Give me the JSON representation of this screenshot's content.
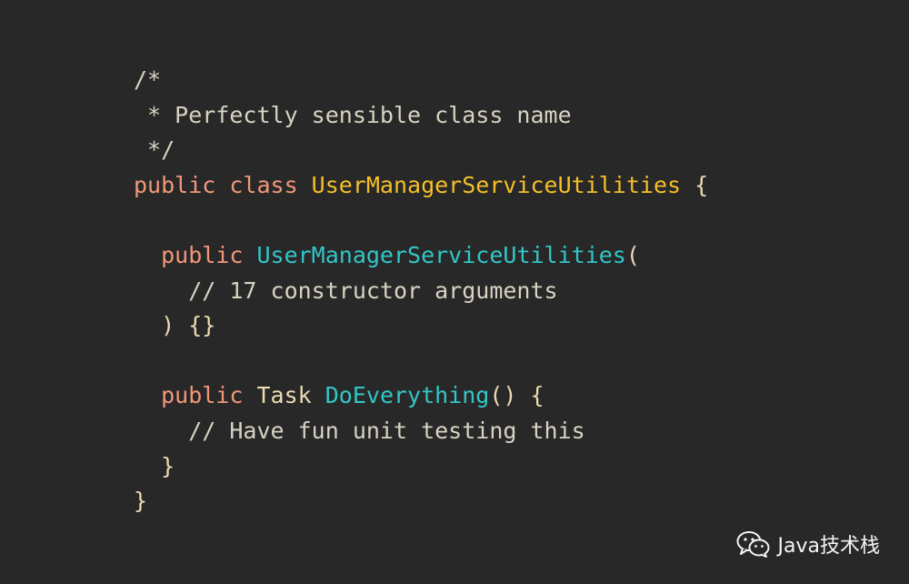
{
  "code": {
    "lines": [
      [
        {
          "t": "/*",
          "c": "cmt"
        }
      ],
      [
        {
          "t": " * Perfectly sensible class name",
          "c": "cmt"
        }
      ],
      [
        {
          "t": " */",
          "c": "cmt"
        }
      ],
      [
        {
          "t": "public class ",
          "c": "kw"
        },
        {
          "t": "UserManagerServiceUtilities",
          "c": "cls"
        },
        {
          "t": " {",
          "c": "pl"
        }
      ],
      [],
      [
        {
          "t": "  public ",
          "c": "kw"
        },
        {
          "t": "UserManagerServiceUtilities",
          "c": "fn"
        },
        {
          "t": "(",
          "c": "pl"
        }
      ],
      [
        {
          "t": "    // 17 constructor arguments",
          "c": "cmt"
        }
      ],
      [
        {
          "t": "  ) {}",
          "c": "pl"
        }
      ],
      [],
      [
        {
          "t": "  public ",
          "c": "kw"
        },
        {
          "t": "Task ",
          "c": "pl"
        },
        {
          "t": "DoEverything",
          "c": "fn"
        },
        {
          "t": "() {",
          "c": "pl"
        }
      ],
      [
        {
          "t": "    // Have fun unit testing this",
          "c": "cmt"
        }
      ],
      [
        {
          "t": "  }",
          "c": "pl"
        }
      ],
      [
        {
          "t": "}",
          "c": "pl"
        }
      ]
    ]
  },
  "watermark": {
    "icon": "wechat-icon",
    "text": "Java技术栈"
  },
  "colors": {
    "background": "#282828",
    "keyword": "#f2977a",
    "class_name": "#f5bf2a",
    "function_name": "#33c6c8",
    "comment": "#d8d3c2",
    "plain": "#ebdbb2"
  }
}
